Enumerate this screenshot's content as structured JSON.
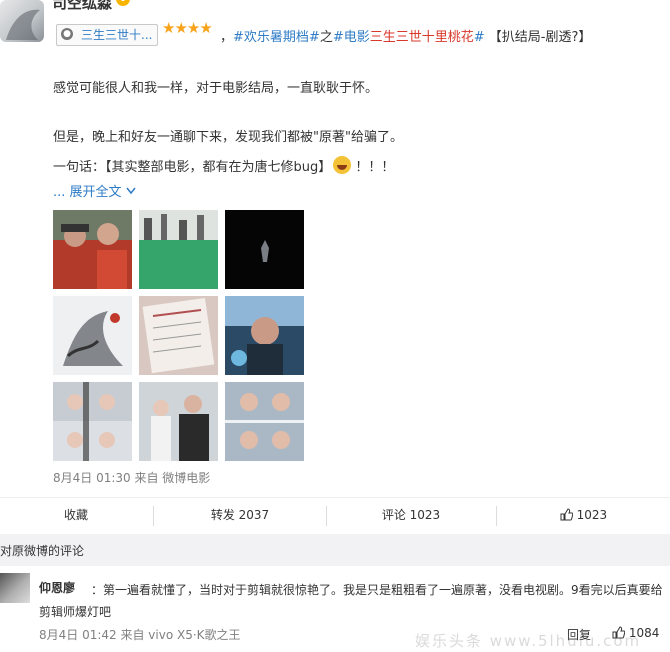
{
  "author": {
    "name": "司空纮淼",
    "badge": "V"
  },
  "movie_tag": {
    "label": "三生三世十..."
  },
  "rating_stars": "★★★★",
  "tags": {
    "sep1": "，",
    "topic1": "#欢乐暑期档#",
    "zhi": "之",
    "topic2_open": "#电影",
    "topic2_title": "三生三世十里桃花",
    "topic2_close": "#",
    "spoiler": " 【扒结局-剧透?】"
  },
  "post": {
    "line1": "感觉可能很人和我一样，对于电影结局，一直耿耿于怀。",
    "line2": "但是，晚上和好友一通聊下来，发现我们都被\"原著\"给骗了。",
    "line3_a": "一句话：【其实整部电影，都有在为唐七修bug】",
    "line3_b": "！！！",
    "expand": "... 展开全文"
  },
  "photos": [
    "photo-1",
    "photo-2",
    "photo-3",
    "photo-4",
    "photo-5",
    "photo-6",
    "photo-7",
    "photo-8",
    "photo-9"
  ],
  "meta": "8月4日 01:30 来自 微博电影",
  "actions": {
    "favorite": "收藏",
    "repost": "转发 2037",
    "comment": "评论 1023",
    "like": "1023"
  },
  "comments_header": "对原微博的评论",
  "comment": {
    "user": "仰恩廖",
    "text": "：第一遍看就懂了，当时对于剪辑就很惊艳了。我是只是粗粗看了一遍原著，没看电视剧。9看完以后真要给剪辑师爆灯吧",
    "meta": "8月4日 01:42 来自 vivo X5·K歌之王",
    "reply": "回复",
    "likes": "1084"
  },
  "watermark": "娱乐头条 www.5lhulu.com"
}
